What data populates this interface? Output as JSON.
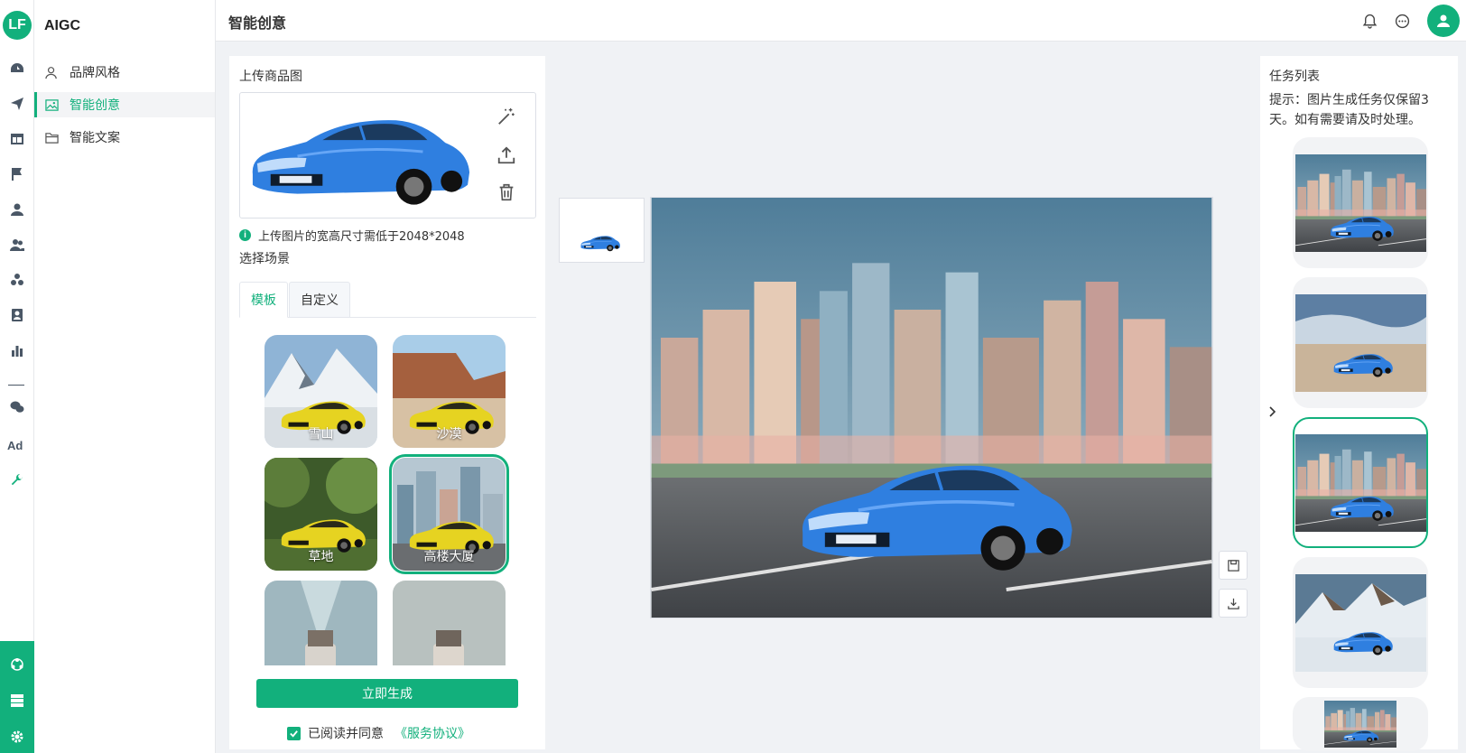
{
  "app": {
    "logo_text": "LF",
    "module_title": "AIGC"
  },
  "sidebar": {
    "items": [
      {
        "label": "品牌风格",
        "icon": "user-outline-icon",
        "active": false
      },
      {
        "label": "智能创意",
        "icon": "image-icon",
        "active": true
      },
      {
        "label": "智能文案",
        "icon": "folder-icon",
        "active": false
      }
    ]
  },
  "rail": {
    "ad_label": "Ad"
  },
  "header": {
    "title": "智能创意"
  },
  "upload": {
    "label": "上传商品图",
    "hint": "上传图片的宽高尺寸需低于2048*2048"
  },
  "scene": {
    "label": "选择场景",
    "tabs": [
      {
        "label": "模板",
        "active": true
      },
      {
        "label": "自定义",
        "active": false
      }
    ],
    "templates": [
      {
        "name": "雪山",
        "selected": false
      },
      {
        "name": "沙漠",
        "selected": false
      },
      {
        "name": "草地",
        "selected": false
      },
      {
        "name": "高楼大厦",
        "selected": true
      },
      {
        "name": "",
        "selected": false
      },
      {
        "name": "",
        "selected": false
      }
    ]
  },
  "actions": {
    "generate_label": "立即生成",
    "agree_text": "已阅读并同意",
    "agree_link": "《服务协议》",
    "agreed": true
  },
  "tasks": {
    "title": "任务列表",
    "hint": "提示：图片生成任务仅保留3天。如有需要请及时处理。",
    "items": [
      {
        "scene": "city",
        "selected": false
      },
      {
        "scene": "beach",
        "selected": false
      },
      {
        "scene": "city",
        "selected": true
      },
      {
        "scene": "snow-mountain",
        "selected": false
      },
      {
        "scene": "city",
        "selected": false
      }
    ]
  },
  "colors": {
    "accent": "#12b07c"
  }
}
